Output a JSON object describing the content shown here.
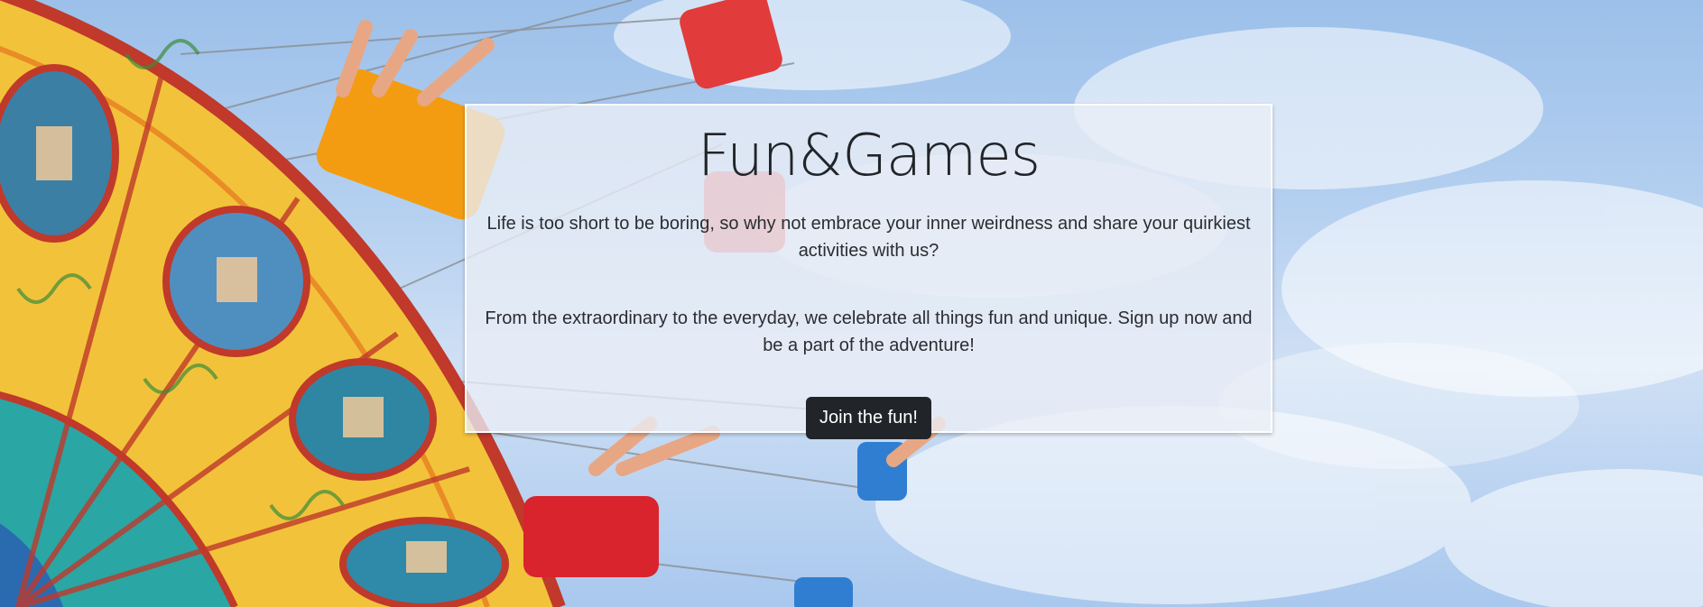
{
  "hero": {
    "background_description": "",
    "colors": {
      "sky": "#a9c8ee",
      "card_bg": "#ebeef6",
      "button_bg": "#212529",
      "button_text": "#ffffff",
      "text": "#212529"
    }
  },
  "card": {
    "title": "Fun&Games",
    "paragraph_1": "Life is too short to be boring, so why not embrace your inner weirdness and share your quirkiest activities with us?",
    "paragraph_2": "From the extraordinary to the everyday, we celebrate all things fun and unique. Sign up now and be a part of the adventure!",
    "cta_label": "Join the fun!"
  }
}
